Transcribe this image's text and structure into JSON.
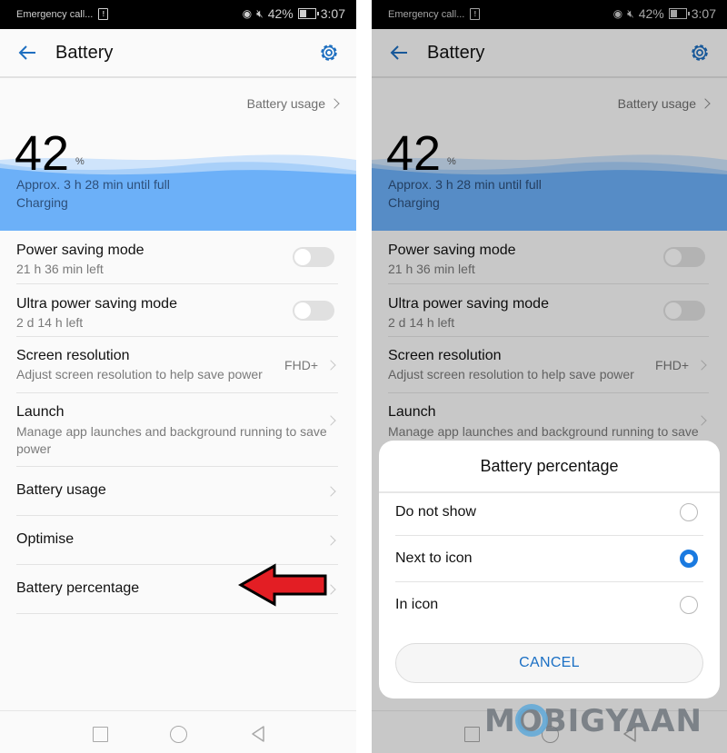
{
  "status_bar": {
    "left_text": "Emergency call...",
    "sim_icon": "sim-alert-icon",
    "icons": [
      "eye-comfort-icon",
      "mute-icon"
    ],
    "battery_text": "42%",
    "battery_icon": "battery-charging-icon",
    "time": "3:07"
  },
  "header": {
    "back_icon": "back-arrow-icon",
    "title": "Battery",
    "settings_icon": "gear-icon"
  },
  "summary": {
    "usage_link": "Battery usage",
    "level": "42",
    "level_unit": "%",
    "estimate": "Approx. 3 h 28 min until full",
    "state": "Charging",
    "level_fraction": 0.42,
    "wave_color": "#6cb0f8"
  },
  "settings": [
    {
      "title": "Power saving mode",
      "subtitle": "21 h 36 min left",
      "control": "toggle",
      "on": false
    },
    {
      "title": "Ultra power saving mode",
      "subtitle": "2 d 14 h left",
      "control": "toggle",
      "on": false
    },
    {
      "title": "Screen resolution",
      "subtitle": "Adjust screen resolution to help save power",
      "value": "FHD+",
      "control": "chevron"
    },
    {
      "title": "Launch",
      "subtitle": "Manage app launches and background running to save power",
      "control": "chevron"
    },
    {
      "title": "Battery usage",
      "control": "chevron"
    },
    {
      "title": "Optimise",
      "control": "chevron"
    },
    {
      "title": "Battery percentage",
      "control": "chevron"
    }
  ],
  "annotation": {
    "icon": "red-arrow-icon",
    "color": "#e31e24",
    "points_to": "Battery percentage"
  },
  "navbar": {
    "icons": [
      "recents-icon",
      "home-icon",
      "back-icon"
    ]
  },
  "dialog": {
    "title": "Battery percentage",
    "options": [
      {
        "label": "Do not show",
        "selected": false
      },
      {
        "label": "Next to icon",
        "selected": true
      },
      {
        "label": "In icon",
        "selected": false
      }
    ],
    "cancel_label": "CANCEL",
    "accent": "#1a7ae0"
  },
  "watermark": {
    "text": "MOBIGYAAN"
  }
}
